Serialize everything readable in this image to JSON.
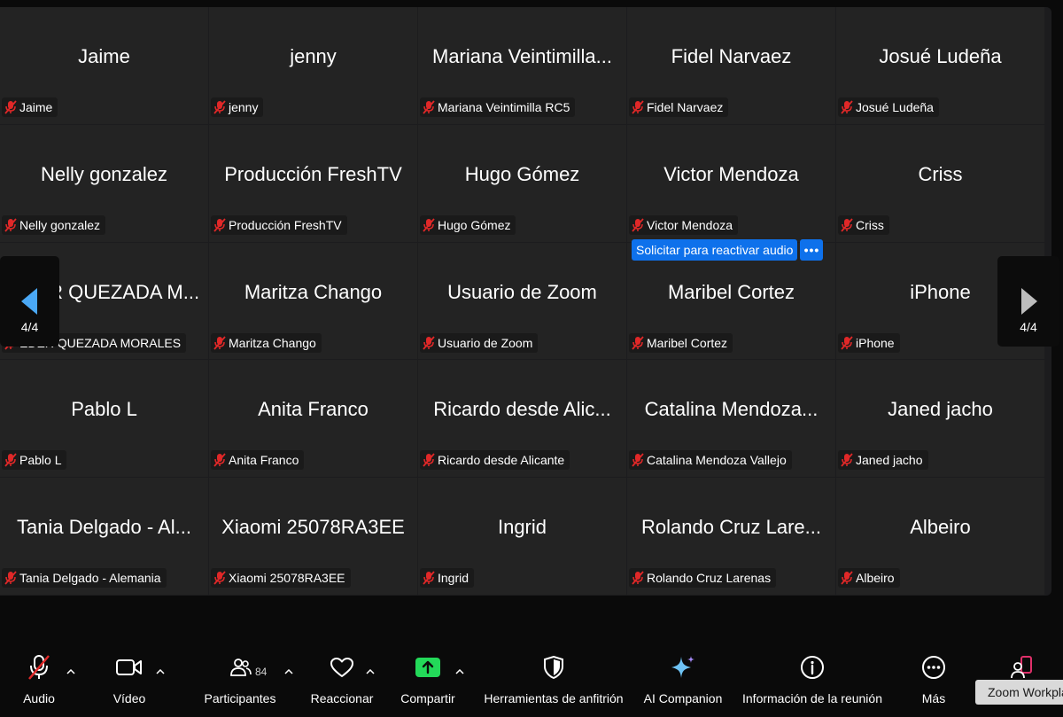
{
  "participants": [
    {
      "display": "Jaime",
      "nametag": "Jaime"
    },
    {
      "display": "jenny",
      "nametag": "jenny"
    },
    {
      "display": "Mariana Veintimilla...",
      "nametag": "Mariana Veintimilla RC5"
    },
    {
      "display": "Fidel Narvaez",
      "nametag": "Fidel Narvaez"
    },
    {
      "display": "Josué Ludeña",
      "nametag": "Josué Ludeña"
    },
    {
      "display": "Nelly gonzalez",
      "nametag": "Nelly gonzalez"
    },
    {
      "display": "Producción FreshTV",
      "nametag": "Producción FreshTV"
    },
    {
      "display": "Hugo Gómez",
      "nametag": "Hugo Gómez"
    },
    {
      "display": "Victor Mendoza",
      "nametag": "Victor Mendoza"
    },
    {
      "display": "Criss",
      "nametag": "Criss"
    },
    {
      "display": "EDER QUEZADA M...",
      "nametag": "EDER QUEZADA MORALES"
    },
    {
      "display": "Maritza Chango",
      "nametag": "Maritza Chango"
    },
    {
      "display": "Usuario de Zoom",
      "nametag": "Usuario de Zoom"
    },
    {
      "display": "Maribel Cortez",
      "nametag": "Maribel Cortez"
    },
    {
      "display": "iPhone",
      "nametag": "iPhone"
    },
    {
      "display": "Pablo L",
      "nametag": "Pablo L"
    },
    {
      "display": "Anita Franco",
      "nametag": "Anita Franco"
    },
    {
      "display": "Ricardo desde Alic...",
      "nametag": "Ricardo desde Alicante"
    },
    {
      "display": "Catalina Mendoza...",
      "nametag": "Catalina Mendoza Vallejo"
    },
    {
      "display": "Janed jacho",
      "nametag": "Janed jacho"
    },
    {
      "display": "Tania Delgado - Al...",
      "nametag": "Tania Delgado - Alemania"
    },
    {
      "display": "Xiaomi 25078RA3EE",
      "nametag": "Xiaomi 25078RA3EE"
    },
    {
      "display": "Ingrid",
      "nametag": "Ingrid"
    },
    {
      "display": "Rolando Cruz Lare...",
      "nametag": "Rolando Cruz Larenas"
    },
    {
      "display": "Albeiro",
      "nametag": "Albeiro"
    }
  ],
  "hover_tile_index": 8,
  "ask_unmute": {
    "label": "Solicitar para reactivar audio",
    "more": "•••"
  },
  "pager": {
    "left_label": "4/4",
    "right_label": "4/4"
  },
  "toolbar": {
    "audio": "Audio",
    "video": "Vídeo",
    "participants": "Participantes",
    "participants_count": "84",
    "react": "Reaccionar",
    "share": "Compartir",
    "host_tools": "Herramientas de anfitrión",
    "ai_companion": "AI Companion",
    "meeting_info": "Información de la reunión",
    "more": "Más"
  },
  "tooltip": "Zoom Workplace",
  "colors": {
    "accent_blue": "#0e71eb",
    "share_green": "#23d959",
    "muted_red": "#e02828",
    "pager_arrow_active": "#4aa8f5"
  },
  "icons": {
    "muted": "mic-muted-icon",
    "audio": "microphone-muted-icon",
    "video": "video-camera-icon",
    "participants": "people-icon",
    "react": "heart-icon",
    "share": "share-arrow-up-icon",
    "host_tools": "shield-icon",
    "ai_companion": "sparkle-icon",
    "meeting_info": "info-icon",
    "more": "ellipsis-icon",
    "apps": "zoom-apps-icon"
  }
}
